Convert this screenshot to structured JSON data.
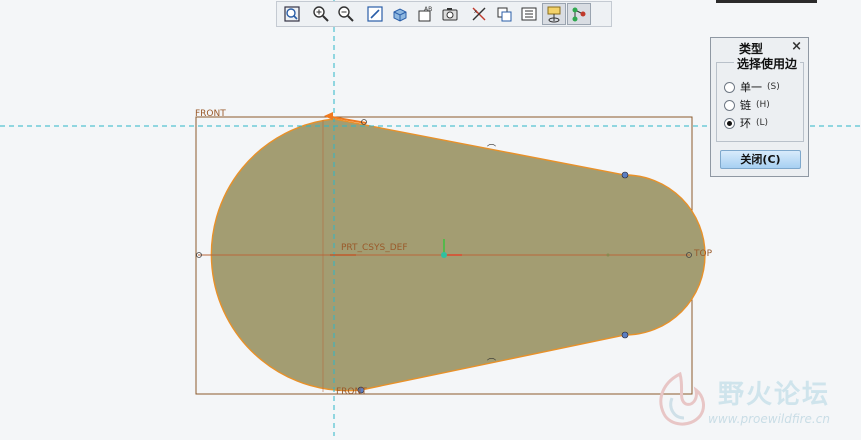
{
  "toolbar": {
    "buttons": [
      {
        "icon": "zoom-fit-icon"
      },
      {
        "icon": "zoom-in-icon"
      },
      {
        "icon": "zoom-out-icon"
      },
      {
        "icon": "repaint-icon"
      },
      {
        "icon": "display-style-icon"
      },
      {
        "icon": "saved-view-icon"
      },
      {
        "icon": "view-manager-icon"
      },
      {
        "icon": "datum-plane-display-icon"
      },
      {
        "icon": "datum-axis-display-icon"
      },
      {
        "icon": "point-display-icon",
        "active": true
      },
      {
        "icon": "csys-display-icon",
        "active": true
      }
    ]
  },
  "dialog": {
    "title": "类型",
    "close_glyph": "×",
    "group_label": "选择使用边",
    "options": [
      {
        "label": "单一",
        "hotkey": "(S)",
        "selected": false
      },
      {
        "label": "链",
        "hotkey": "(H)",
        "selected": false
      },
      {
        "label": "环",
        "hotkey": "(L)",
        "selected": true
      }
    ],
    "close_button_label": "关闭(C)"
  },
  "sketch": {
    "labels": {
      "front_top": "FRONT",
      "front_bottom": "FRONT",
      "csys": "PRT_CSYS_DEF",
      "top": "TOP"
    },
    "colors": {
      "fill": "#a39d72",
      "edge": "#e8912a",
      "axis": "#2bb7c9",
      "frame": "#8b5a2b"
    }
  },
  "watermark": {
    "name": "野火论坛",
    "url": "www.proewildfire.cn"
  }
}
